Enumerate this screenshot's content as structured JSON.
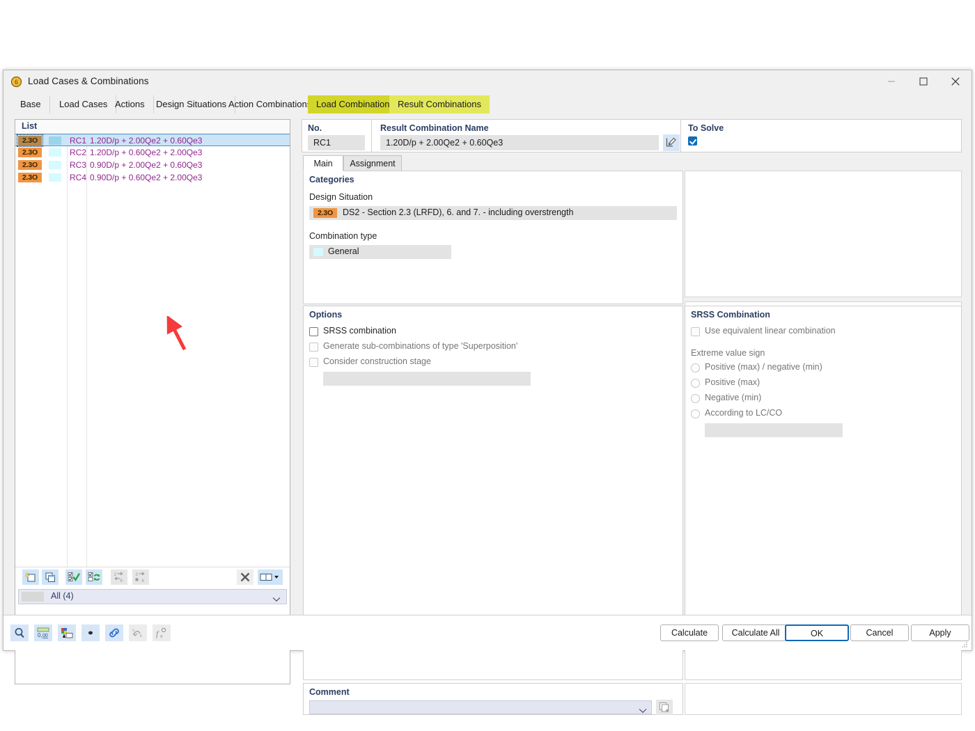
{
  "window": {
    "title": "Load Cases & Combinations",
    "icon": "app-icon",
    "minimize": "–",
    "maximize": "□",
    "close": "✕"
  },
  "tabs": [
    {
      "label": "Base",
      "state": "normal"
    },
    {
      "label": "Load Cases",
      "state": "normal"
    },
    {
      "label": "Actions",
      "state": "normal"
    },
    {
      "label": "Design Situations",
      "state": "normal"
    },
    {
      "label": "Action Combinations",
      "state": "normal"
    },
    {
      "label": "Load Combinations",
      "state": "highlight"
    },
    {
      "label": "Result Combinations",
      "state": "active"
    }
  ],
  "list": {
    "header": "List",
    "rows": [
      {
        "badge": "2.3O",
        "id": "RC1",
        "description": "1.20D/p + 2.00Qe2 + 0.60Qe3",
        "selected": true
      },
      {
        "badge": "2.3O",
        "id": "RC2",
        "description": "1.20D/p + 0.60Qe2 + 2.00Qe3",
        "selected": false
      },
      {
        "badge": "2.3O",
        "id": "RC3",
        "description": "0.90D/p + 2.00Qe2 + 0.60Qe3",
        "selected": false
      },
      {
        "badge": "2.3O",
        "id": "RC4",
        "description": "0.90D/p + 0.60Qe2 + 2.00Qe3",
        "selected": false
      }
    ],
    "toolbar": [
      {
        "name": "new-item-button",
        "enabled": true
      },
      {
        "name": "copy-item-button",
        "enabled": true
      },
      {
        "name": "select-all-button",
        "enabled": true
      },
      {
        "name": "invert-selection-button",
        "enabled": true
      },
      {
        "name": "renumber-button",
        "enabled": false
      },
      {
        "name": "set-number-button",
        "enabled": false
      },
      {
        "name": "delete-button",
        "enabled": false
      },
      {
        "name": "view-mode-button",
        "enabled": true
      }
    ],
    "filter": "All (4)"
  },
  "detail": {
    "no_label": "No.",
    "no_value": "RC1",
    "name_label": "Result Combination Name",
    "name_value": "1.20D/p + 2.00Qe2 + 0.60Qe3",
    "edit_button": "edit-pencil-icon",
    "to_solve_label": "To Solve",
    "to_solve_checked": true,
    "inner_tabs": [
      {
        "label": "Main",
        "active": true
      },
      {
        "label": "Assignment",
        "active": false
      }
    ],
    "categories": {
      "title": "Categories",
      "design_situation_label": "Design Situation",
      "design_situation_badge": "2.3O",
      "design_situation_value": "DS2 - Section 2.3 (LRFD), 6. and 7. - including overstrength",
      "combination_type_label": "Combination type",
      "combination_type_value": "General"
    },
    "options": {
      "title": "Options",
      "items": [
        {
          "label": "SRSS combination",
          "checked": false,
          "enabled": true
        },
        {
          "label": "Generate sub-combinations of type 'Superposition'",
          "checked": false,
          "enabled": false
        },
        {
          "label": "Consider construction stage",
          "checked": false,
          "enabled": false
        }
      ],
      "stage_value": ""
    },
    "srss": {
      "title": "SRSS Combination",
      "use_equivalent_label": "Use equivalent linear combination",
      "use_equivalent_checked": false,
      "extreme_value_label": "Extreme value sign",
      "radios": [
        {
          "label": "Positive (max) / negative (min)",
          "selected": false
        },
        {
          "label": "Positive (max)",
          "selected": false
        },
        {
          "label": "Negative (min)",
          "selected": false
        },
        {
          "label": "According to LC/CO",
          "selected": false
        }
      ],
      "lcco_value": ""
    },
    "comment": {
      "label": "Comment",
      "value": "",
      "copy_button": "copy-comment-icon"
    }
  },
  "bottom": {
    "icons": [
      {
        "name": "search-magnifier-icon",
        "enabled": true
      },
      {
        "name": "decimal-places-icon",
        "enabled": true
      },
      {
        "name": "colors-icon",
        "enabled": true
      },
      {
        "name": "dot-icon",
        "enabled": true
      },
      {
        "name": "link-icon",
        "enabled": true
      },
      {
        "name": "units-icon",
        "enabled": false
      },
      {
        "name": "formula-icon",
        "enabled": false
      }
    ],
    "buttons": [
      {
        "label": "Calculate",
        "default": false
      },
      {
        "label": "Calculate All",
        "default": false
      },
      {
        "label": "OK",
        "default": true
      },
      {
        "label": "Cancel",
        "default": false
      },
      {
        "label": "Apply",
        "default": false
      }
    ]
  },
  "annotation": {
    "arrow_color": "#f53b3b"
  }
}
